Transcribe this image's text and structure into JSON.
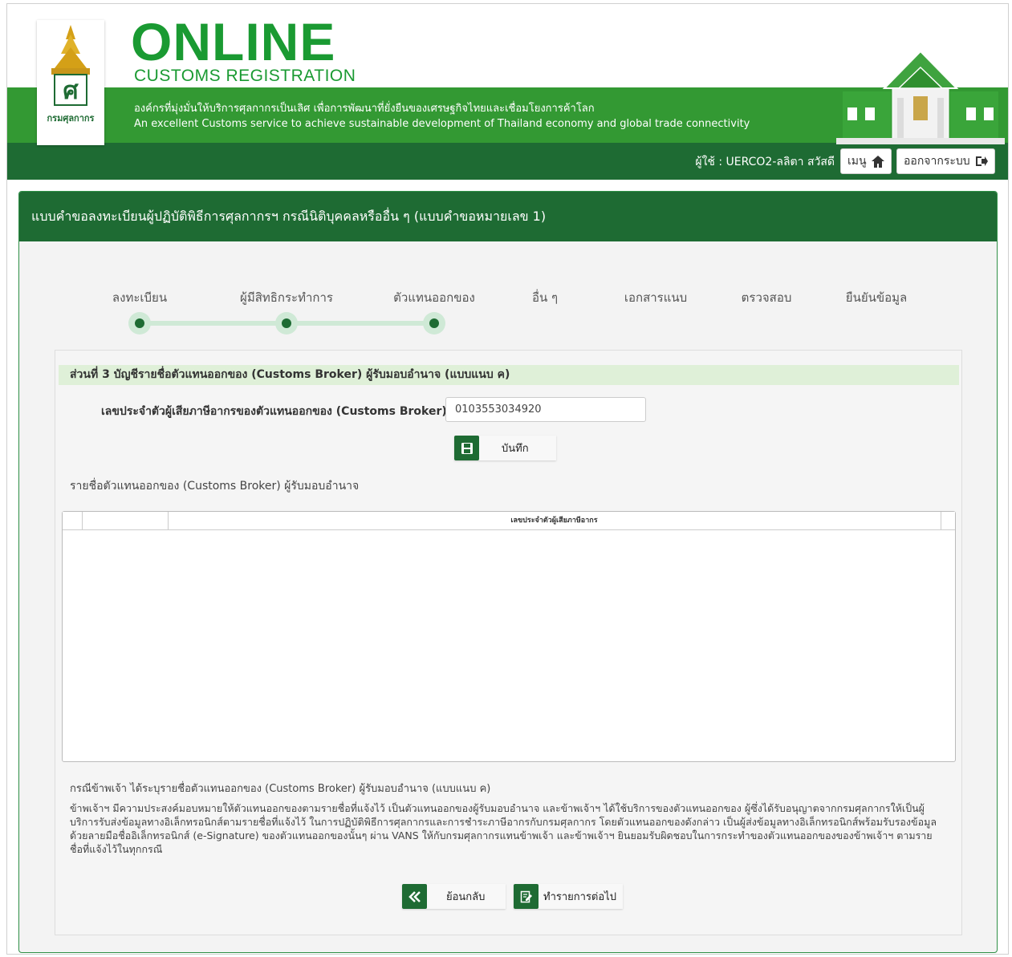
{
  "header": {
    "title": "ONLINE",
    "subtitle": "CUSTOMS  REGISTRATION",
    "logo_text": "กรมศุลกากร",
    "slogan_th": "องค์กรที่มุ่งมั่นให้บริการศุลกากรเป็นเลิศ เพื่อการพัฒนาที่ยั่งยืนของเศรษฐกิจไทยและเชื่อมโยงการค้าโลก",
    "slogan_en": "An excellent Customs service to achieve sustainable development of Thailand economy and global trade connectivity",
    "user_label": "ผู้ใช้ : UERCO2-ลลิตา สวัสดี",
    "menu_label": "เมนู",
    "logout_label": "ออกจากระบบ"
  },
  "panel": {
    "title": "แบบคำขอลงทะเบียนผู้ปฏิบัติพิธีการศุลกากรฯ กรณีนิติบุคคลหรืออื่น ๆ (แบบคำขอหมายเลข 1)"
  },
  "steps": [
    {
      "label": "ลงทะเบียน",
      "done": true
    },
    {
      "label": "ผู้มีสิทธิกระทำการ",
      "done": true
    },
    {
      "label": "ตัวแทนออกของ",
      "done": true
    },
    {
      "label": "อื่น ๆ",
      "done": false
    },
    {
      "label": "เอกสารแนบ",
      "done": false
    },
    {
      "label": "ตรวจสอบ",
      "done": false
    },
    {
      "label": "ยืนยันข้อมูล",
      "done": false
    }
  ],
  "section": {
    "title": "ส่วนที่ 3 บัญชีรายชื่อตัวแทนออกของ (Customs Broker) ผู้รับมอบอำนาจ (แบบแนบ ค)",
    "field_label": "เลขประจำตัวผู้เสียภาษีอากรของตัวแทนออกของ (Customs Broker) :",
    "field_value": "0103553034920",
    "save_label": "บันทึก",
    "list_title": "รายชื่อตัวแทนออกของ (Customs Broker) ผู้รับมอบอำนาจ",
    "grid_column": "เลขประจำตัวผู้เสียภาษีอากร"
  },
  "note": {
    "title": "กรณีข้าพเจ้า ได้ระบุรายชื่อตัวแทนออกของ (Customs Broker) ผู้รับมอบอำนาจ (แบบแนบ ค)",
    "body": "ข้าพเจ้าฯ มีความประสงค์มอบหมายให้ตัวแทนออกของตามรายชื่อที่แจ้งไว้ เป็นตัวแทนออกของผู้รับมอบอำนาจ และข้าพเจ้าฯ ได้ใช้บริการของตัวแทนออกของ ผู้ซึ่งได้รับอนุญาตจากกรมศุลกากรให้เป็นผู้บริการรับส่งข้อมูลทางอิเล็กทรอนิกส์ตามรายชื่อที่แจ้งไว้ ในการปฏิบัติพิธีการศุลกากรและการชำระภาษีอากรกับกรมศุลกากร โดยตัวแทนออกของดังกล่าว เป็นผู้ส่งข้อมูลทางอิเล็กทรอนิกส์พร้อมรับรองข้อมูลด้วยลายมือชื่ออิเล็กทรอนิกส์ (e-Signature) ของตัวแทนออกของนั้นๆ ผ่าน VANS ให้กับกรมศุลกากรแทนข้าพเจ้า และข้าพเจ้าฯ ยินยอมรับผิดชอบในการกระทำของตัวแทนออกของของข้าพเจ้าฯ ตามรายชื่อที่แจ้งไว้ในทุกกรณี"
  },
  "footer": {
    "back_label": "ย้อนกลับ",
    "next_label": "ทำรายการต่อไป"
  },
  "colors": {
    "brand_dark": "#1e6b33",
    "brand": "#339933",
    "step_light": "#cfe9d6",
    "section_bg": "#dff0d8"
  }
}
